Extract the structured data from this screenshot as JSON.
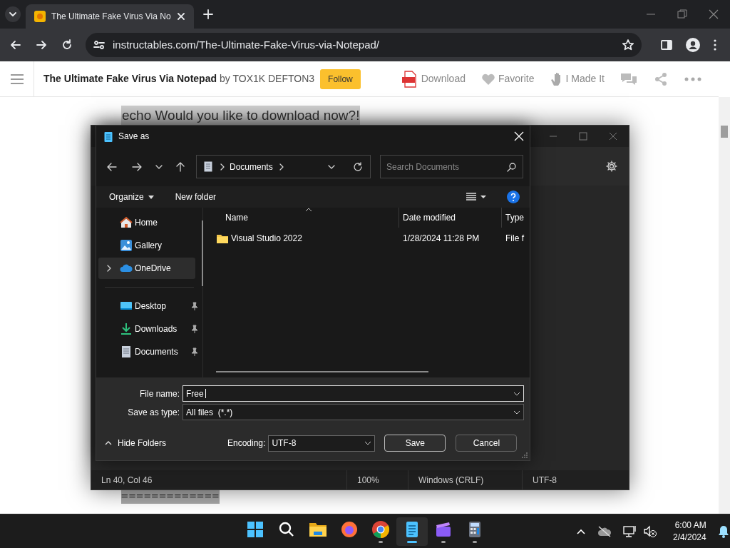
{
  "browser": {
    "tab": {
      "title": "The Ultimate Fake Virus Via No"
    },
    "url": "instructables.com/The-Ultimate-Fake-Virus-via-Notepad/"
  },
  "page": {
    "title": "The Ultimate Fake Virus Via Notepad",
    "byline": "by TOX1K DEFTON3",
    "follow": "Follow",
    "actions": [
      {
        "kind": "download",
        "label": "Download"
      },
      {
        "kind": "favorite",
        "label": "Favorite"
      },
      {
        "kind": "made",
        "label": "I Made It"
      },
      {
        "kind": "comments"
      },
      {
        "kind": "share"
      },
      {
        "kind": "more"
      }
    ],
    "lines": [
      "echo Would you like to download now?!",
      "============="
    ]
  },
  "notepad": {
    "status": [
      "Ln 40, Col 46",
      "100%",
      "Windows (CRLF)",
      "UTF-8"
    ]
  },
  "dialog": {
    "title": "Save as",
    "path": "Documents",
    "search_placeholder": "Search Documents",
    "toolbar": [
      "Organize",
      "New folder"
    ],
    "nav": [
      {
        "items": [
          {
            "kind": "home",
            "label": "Home",
            "selected": false,
            "expandable": false,
            "pinned": false
          },
          {
            "kind": "gallery",
            "label": "Gallery",
            "selected": false,
            "expandable": false,
            "pinned": false
          },
          {
            "kind": "onedrive",
            "label": "OneDrive",
            "selected": true,
            "expandable": true,
            "pinned": false
          }
        ]
      },
      {
        "items": [
          {
            "kind": "desktop",
            "label": "Desktop",
            "selected": false,
            "expandable": false,
            "pinned": true
          },
          {
            "kind": "downloads",
            "label": "Downloads",
            "selected": false,
            "expandable": false,
            "pinned": true
          },
          {
            "kind": "documents",
            "label": "Documents",
            "selected": false,
            "expandable": false,
            "pinned": true
          }
        ]
      }
    ],
    "columns": [
      "Name",
      "Date modified",
      "Type"
    ],
    "rows": [
      {
        "kind": "folder",
        "name": "Visual Studio 2022",
        "date": "1/28/2024 11:28 PM",
        "type": "File f"
      }
    ],
    "file_name_label": "File name:",
    "file_name": "Free",
    "type_label": "Save as type:",
    "type_value": "All files  (*.*)",
    "hide_folders": "Hide Folders",
    "encoding_label": "Encoding:",
    "encoding": "UTF-8",
    "buttons": [
      "Save",
      "Cancel"
    ]
  },
  "taskbar": {
    "apps": [
      {
        "kind": "start",
        "selected": false,
        "running": false
      },
      {
        "kind": "search",
        "selected": false,
        "running": false
      },
      {
        "kind": "explorer",
        "selected": false,
        "running": false
      },
      {
        "kind": "firefox",
        "selected": false,
        "running": false
      },
      {
        "kind": "chrome",
        "selected": false,
        "running": true
      },
      {
        "kind": "notepad",
        "selected": true,
        "running": true
      },
      {
        "kind": "clipchamp",
        "selected": false,
        "running": true
      },
      {
        "kind": "calculator",
        "selected": false,
        "running": true
      }
    ],
    "time": "6:00 AM",
    "date": "2/4/2024"
  }
}
